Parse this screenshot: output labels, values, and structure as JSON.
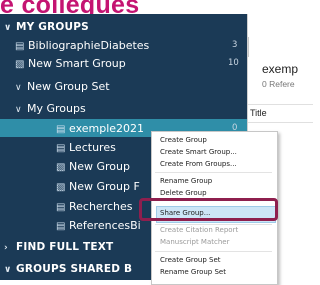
{
  "banner": {
    "title": "e collègues"
  },
  "sidebar": {
    "sections": {
      "my_groups": "MY GROUPS",
      "find_full_text": "FIND FULL TEXT",
      "groups_shared": "GROUPS SHARED B"
    },
    "items": [
      {
        "label": "BibliographieDiabetes",
        "count": "3"
      },
      {
        "label": "New Smart Group",
        "count": "10"
      },
      {
        "label": "New Group Set"
      },
      {
        "label": "My Groups"
      },
      {
        "label": "exemple2021",
        "count": "0"
      },
      {
        "label": "Lectures"
      },
      {
        "label": "New Group"
      },
      {
        "label": "New Group F"
      },
      {
        "label": "Recherches"
      },
      {
        "label": "ReferencesBi"
      }
    ]
  },
  "right_panel": {
    "title": "exemp",
    "subtitle": "0 Refere",
    "column_header": "Title"
  },
  "context_menu": {
    "items": [
      {
        "label": "Create Group",
        "disabled": false
      },
      {
        "label": "Create Smart Group...",
        "disabled": false
      },
      {
        "label": "Create From Groups...",
        "disabled": false
      },
      {
        "label": "Rename Group",
        "disabled": false
      },
      {
        "label": "Delete Group",
        "disabled": false
      },
      {
        "label": "Share Group...",
        "disabled": false,
        "highlighted": true
      },
      {
        "label": "Create Citation Report",
        "disabled": true
      },
      {
        "label": "Manuscript Matcher",
        "disabled": true
      },
      {
        "label": "Create Group Set",
        "disabled": false
      },
      {
        "label": "Rename Group Set",
        "disabled": false
      }
    ]
  },
  "colors": {
    "sidebar_bg": "#1b3a56",
    "selected_bg": "#2f8ea8",
    "banner_text": "#c41472",
    "callout_border": "#8e1f4e",
    "menu_highlight": "#cde6f7"
  }
}
